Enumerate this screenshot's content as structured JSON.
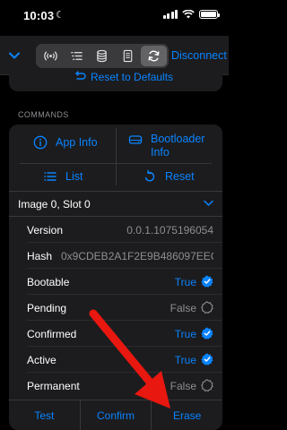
{
  "status": {
    "time": "10:03"
  },
  "nav": {
    "disconnect_label": "Disconnect",
    "segments": [
      "antenna-icon",
      "list-icon",
      "database-icon",
      "document-icon",
      "sync-icon"
    ],
    "active_segment": 4
  },
  "reset": {
    "label": "Reset to Defaults"
  },
  "commands": {
    "header": "COMMANDS",
    "app_info": "App Info",
    "bootloader_info_1": "Bootloader",
    "bootloader_info_2": "Info",
    "list": "List",
    "reset": "Reset"
  },
  "image": {
    "title": "Image 0, Slot 0",
    "properties": [
      {
        "key": "Version",
        "value": "0.0.1.1075196054"
      },
      {
        "key": "Hash",
        "value": "0x9CDEB2A1F2E9B486097EEC..."
      },
      {
        "key": "Bootable",
        "value": "True",
        "state": true
      },
      {
        "key": "Pending",
        "value": "False",
        "state": false
      },
      {
        "key": "Confirmed",
        "value": "True",
        "state": true
      },
      {
        "key": "Active",
        "value": "True",
        "state": true
      },
      {
        "key": "Permanent",
        "value": "False",
        "state": false
      }
    ]
  },
  "actions": {
    "test": "Test",
    "confirm": "Confirm",
    "erase": "Erase"
  },
  "colors": {
    "accent": "#0a84ff",
    "annotation_arrow": "#e8170f",
    "background": "#000000",
    "card": "#1c1c1e"
  }
}
